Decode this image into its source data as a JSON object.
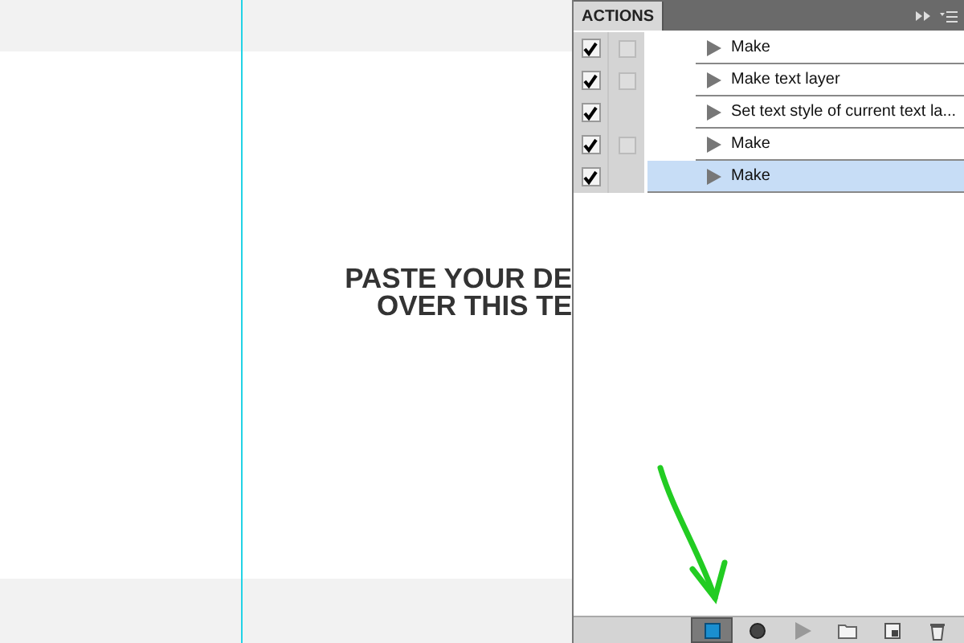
{
  "canvas": {
    "lines": [
      "PASTE YOUR DE",
      "OVER THIS TE"
    ]
  },
  "panel": {
    "title": "ACTIONS",
    "steps": [
      {
        "label": "Make",
        "checked": true,
        "dialog_toggle": true,
        "selected": false
      },
      {
        "label": "Make text layer",
        "checked": true,
        "dialog_toggle": true,
        "selected": false
      },
      {
        "label": "Set text style of current text la...",
        "checked": true,
        "dialog_toggle": false,
        "selected": false
      },
      {
        "label": "Make",
        "checked": true,
        "dialog_toggle": true,
        "selected": false
      },
      {
        "label": "Make",
        "checked": true,
        "dialog_toggle": false,
        "selected": true
      }
    ],
    "toolbar": [
      {
        "kind": "stop",
        "pressed": true
      },
      {
        "kind": "record",
        "pressed": false
      },
      {
        "kind": "play",
        "pressed": false
      },
      {
        "kind": "folder",
        "pressed": false
      },
      {
        "kind": "new",
        "pressed": false
      },
      {
        "kind": "trash",
        "pressed": false
      }
    ]
  }
}
